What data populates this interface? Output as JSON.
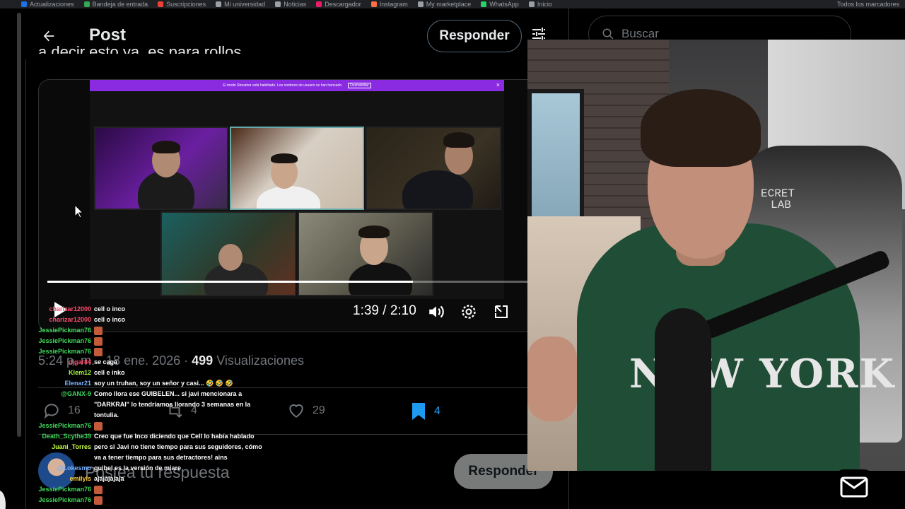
{
  "browser": {
    "bookmarks": [
      {
        "label": "Actualizaciones",
        "color": "#1a73e8"
      },
      {
        "label": "Bandeja de entrada",
        "color": "#34a853"
      },
      {
        "label": "Suscripciones",
        "color": "#ea4335"
      },
      {
        "label": "Mi universidad",
        "color": "#9aa0a6"
      },
      {
        "label": "Noticias",
        "color": "#9aa0a6"
      },
      {
        "label": "Descargador",
        "color": "#e91e63"
      },
      {
        "label": "Instagram",
        "color": "#ff7043"
      },
      {
        "label": "My marketplace",
        "color": "#9aa0a6"
      },
      {
        "label": "WhatsApp",
        "color": "#25d366"
      },
      {
        "label": "Inicio",
        "color": "#9aa0a6"
      }
    ],
    "all_bookmarks": "Todos los marcadores"
  },
  "header": {
    "title": "Post",
    "reply_label": "Responder",
    "text_snippet": "a decir esto ya, es para rollos"
  },
  "search": {
    "placeholder": "Buscar"
  },
  "video": {
    "banner_text": "El modo Streamer está habilitado. Los nombres de usuario se han truncado.",
    "banner_button": "Deshabilitar",
    "time": "1:39 / 2:10",
    "progress": 0.76
  },
  "post_meta": {
    "time": "5:24 p. m.",
    "date": "18 ene. 2026",
    "views_count": "499",
    "views_label": "Visualizaciones"
  },
  "actions": {
    "replies": "16",
    "reposts": "4",
    "likes": "29",
    "bookmarks": "4"
  },
  "composer": {
    "placeholder": "Postea tu respuesta",
    "reply_label": "Responder"
  },
  "chat": [
    {
      "user": "charizar12000",
      "text": "cell o inco",
      "color": "#ff4a6e",
      "emote": false
    },
    {
      "user": "charizar12000",
      "text": "cell o inco",
      "color": "#ff4a6e",
      "emote": false
    },
    {
      "user": "JessiePickman76",
      "text": "",
      "color": "#3fd85a",
      "emote": true
    },
    {
      "user": "JessiePickman76",
      "text": "",
      "color": "#3fd85a",
      "emote": true
    },
    {
      "user": "JessiePickman76",
      "text": "",
      "color": "#3fd85a",
      "emote": true
    },
    {
      "user": "djgar84",
      "text": "se caga",
      "color": "#ff4a6e",
      "emote": false
    },
    {
      "user": "Klem12",
      "text": "cell e inko",
      "color": "#a6ff3f",
      "emote": false
    },
    {
      "user": "Elenar21",
      "text": "soy un truhan, soy un señor y casi... 🤣 🤣 🤣",
      "color": "#7ab0ff",
      "emote": false
    },
    {
      "user": "@GANX-9",
      "text": "Como llora ese GUIBELEN... si javi mencionara a \"DARKRAI\" lo tendriamos llorando 3 semanas en la tontulia.",
      "color": "#3fd85a",
      "emote": false
    },
    {
      "user": "JessiePickman76",
      "text": "",
      "color": "#3fd85a",
      "emote": true
    },
    {
      "user": "Death_Scythe39",
      "text": "Creo que fue Inco diciendo que Cell lo había hablado",
      "color": "#3fd85a",
      "emote": false
    },
    {
      "user": "Juani_Torres",
      "text": "pero si Javi no tiene tiempo para sus seguidores, cómo va a tener tiempo para sus detractores! ains",
      "color": "#c8ff3f",
      "emote": false
    },
    {
      "user": "@Lokesmo",
      "text": "guibel es la versión de miare",
      "color": "#7ab0ff",
      "emote": false
    },
    {
      "user": "emilyis",
      "text": "ajajajajaja",
      "color": "#ffcf3f",
      "emote": false
    },
    {
      "user": "JessiePickman76",
      "text": "",
      "color": "#3fd85a",
      "emote": true
    },
    {
      "user": "JessiePickman76",
      "text": "",
      "color": "#3fd85a",
      "emote": true
    }
  ],
  "webcam": {
    "chair_logo_line1": "ECRET",
    "chair_logo_line2": "LAB",
    "shirt_text": "NEW YORK"
  }
}
